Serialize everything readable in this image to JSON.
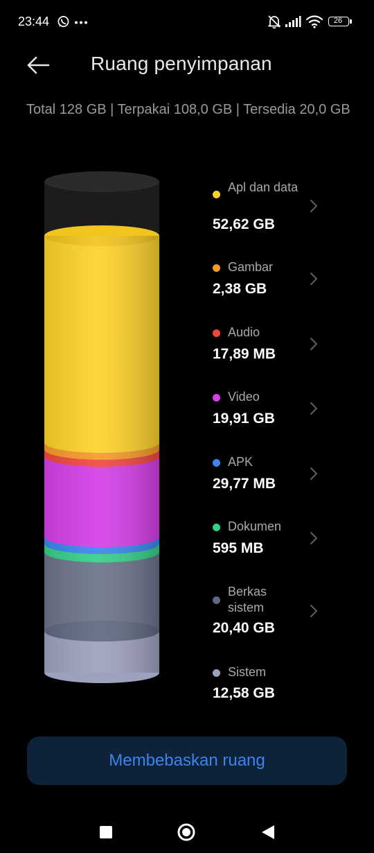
{
  "status_bar": {
    "time": "23:44",
    "left_icons": [
      "whatsapp-icon",
      "more-dots-icon"
    ],
    "right_icons": [
      "mute-bell-icon",
      "signal-icon",
      "wifi-icon",
      "battery-icon"
    ],
    "battery_level": "26"
  },
  "header": {
    "title": "Ruang penyimpanan",
    "back_icon": "back-arrow-icon"
  },
  "summary": "Total 128 GB | Terpakai 108,0 GB | Tersedia 20,0 GB",
  "categories": [
    {
      "label": "Apl dan data",
      "value": "52,62 GB",
      "color": "#fdd22a",
      "chevron": true
    },
    {
      "label": "Gambar",
      "value": "2,38 GB",
      "color": "#f59a2a",
      "chevron": true
    },
    {
      "label": "Audio",
      "value": "17,89 MB",
      "color": "#f1473f",
      "chevron": true
    },
    {
      "label": "Video",
      "value": "19,91 GB",
      "color": "#d53ee8",
      "chevron": true
    },
    {
      "label": "APK",
      "value": "29,77 MB",
      "color": "#3b86ee",
      "chevron": true
    },
    {
      "label": "Dokumen",
      "value": "595 MB",
      "color": "#36cf88",
      "chevron": true
    },
    {
      "label": "Berkas sistem",
      "value": "20,40 GB",
      "color": "#5f6880",
      "chevron": true
    },
    {
      "label": "Sistem",
      "value": "12,58 GB",
      "color": "#9ea1bd",
      "chevron": false
    }
  ],
  "free_button": {
    "label": "Membebaskan ruang",
    "color": "#3b84ee"
  },
  "nav": {
    "icons": [
      "recents-square-icon",
      "home-circle-icon",
      "back-triangle-icon"
    ]
  }
}
